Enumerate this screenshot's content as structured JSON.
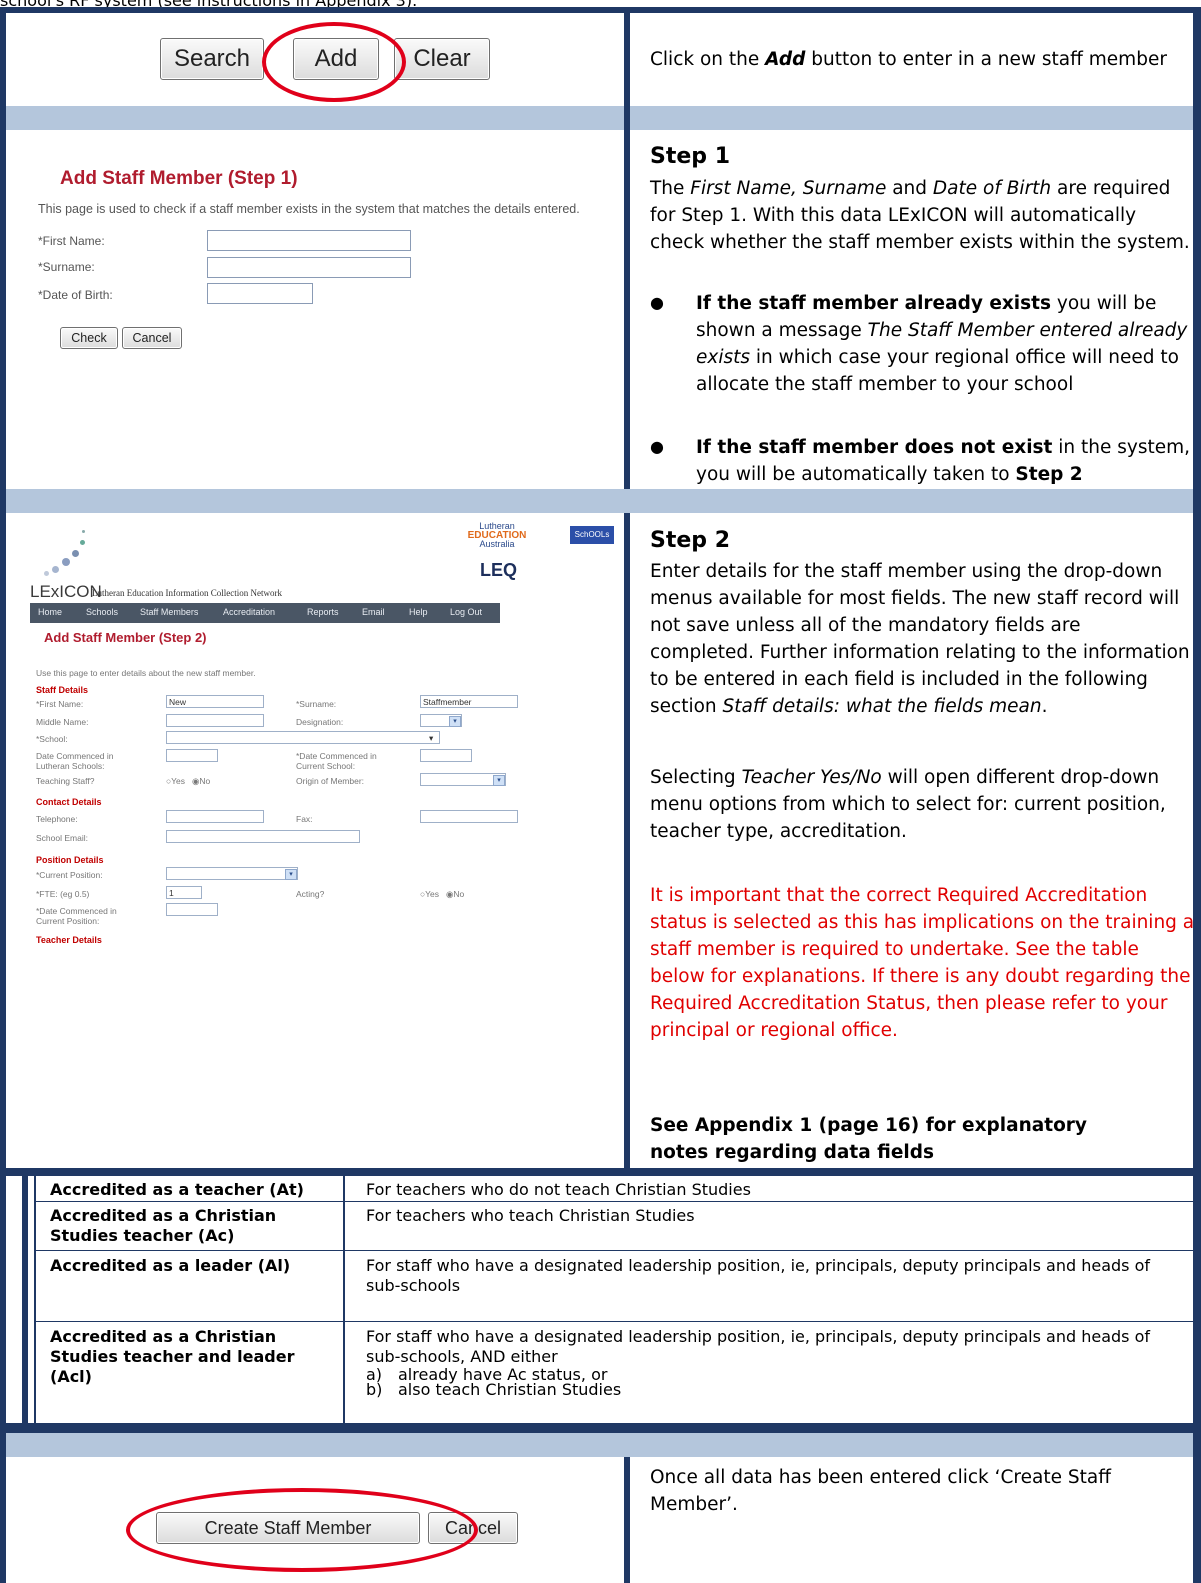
{
  "top_caption": "school's RF system (see instructions in Appendix 3).",
  "row1": {
    "buttons": [
      "Search",
      "Add",
      "Clear"
    ],
    "instruction_pre": "Click on the ",
    "instruction_em": "Add",
    "instruction_post": " button to enter in a new staff member"
  },
  "step1": {
    "screenshot": {
      "title": "Add Staff Member (Step 1)",
      "intro": "This page is used to check if a staff member exists in the system that matches the details entered.",
      "fields": [
        "*First Name:",
        "*Surname:",
        "*Date of Birth:"
      ],
      "buttons": [
        "Check",
        "Cancel"
      ]
    },
    "heading": "Step 1",
    "p1_a": "The ",
    "p1_em1": "First Name, Surname",
    "p1_b": " and ",
    "p1_em2": "Date of Birth",
    "p1_c": " are required for Step 1. With this data LExICON will automatically check whether the staff member exists within the system.",
    "bullet1_bold": "If the staff member already exists",
    "bullet1_a": " you will be shown a message ",
    "bullet1_em": "The Staff Member entered already exists",
    "bullet1_b": " in which case your regional office will need to allocate the staff member to your school",
    "bullet2_bold": "If the staff member does not exist",
    "bullet2_a": " in the system, you will be automatically taken to ",
    "bullet2_bold2": "Step 2"
  },
  "step2": {
    "screenshot": {
      "logo_top": "Lutheran",
      "logo_edu": "EDUCATION",
      "logo_aus": "Australia",
      "logo_schools": "SchOOLs",
      "logo_leq": "LEQ",
      "lexicon": "LExICON",
      "lexicon_sub": "Lutheran Education Information Collection Network",
      "nav": [
        "Home",
        "Schools",
        "Staff Members",
        "Accreditation",
        "Reports",
        "Email",
        "Help",
        "Log Out"
      ],
      "title": "Add Staff Member (Step 2)",
      "intro": "Use this page to enter details about the new staff member.",
      "staff_details": "Staff Details",
      "first_name_label": "*First Name:",
      "first_name_value": "New",
      "surname_label": "*Surname:",
      "surname_value": "Staffmember",
      "middle_name_label": "Middle Name:",
      "designation_label": "Designation:",
      "school_label": "*School:",
      "date_lutheran_label": "Date Commenced in Lutheran Schools:",
      "date_current_school_label": "*Date Commenced in Current School:",
      "teaching_label": "Teaching Staff?",
      "yes": "Yes",
      "no": "No",
      "origin_label": "Origin of Member:",
      "contact_details": "Contact Details",
      "telephone_label": "Telephone:",
      "fax_label": "Fax:",
      "school_email_label": "School Email:",
      "position_details": "Position Details",
      "current_position_label": "*Current Position:",
      "fte_label": "*FTE: (eg 0.5)",
      "fte_value": "1",
      "acting_label": "Acting?",
      "date_current_position_label": "*Date Commenced in Current Position:",
      "teacher_details": "Teacher Details"
    },
    "heading": "Step 2",
    "p1_a": "Enter details for the staff member using the drop-down menus available for most fields. The new staff record will not save unless all of the mandatory fields are completed. Further information relating to the information to be entered in each field is included in the following section ",
    "p1_em": "Staff details: what the fields mean",
    "p1_b": ".",
    "p2_a": "Selecting ",
    "p2_em": "Teacher Yes/No",
    "p2_b": " will open different drop-down menu options from which to select for: current position, teacher type, accreditation.",
    "p3_red": "It is important that the correct Required Accreditation status is selected as this has implications on the training a staff member is required to undertake. See the table below for explanations. If there is any doubt regarding the Required Accreditation Status, then please refer to your principal or regional office.",
    "p4_bold": "See Appendix 1 (page 16) for explanatory notes regarding data fields"
  },
  "accreditation_table": [
    {
      "status": "Accredited as a teacher (At)",
      "desc": "For teachers who do not teach Christian Studies"
    },
    {
      "status": "Accredited as a Christian Studies teacher (Ac)",
      "desc": "For teachers who teach Christian Studies"
    },
    {
      "status": "Accredited as a leader (Al)",
      "desc": "For staff who have a designated leadership position, ie, principals, deputy principals and heads of sub-schools"
    },
    {
      "status": "Accredited as a Christian Studies teacher and leader (Acl)",
      "desc": "For staff who have a designated leadership position, ie, principals, deputy principals and heads of sub-schools, AND either",
      "sub": [
        [
          "a)",
          "already have Ac status, or"
        ],
        [
          "b)",
          "also teach Christian Studies"
        ]
      ]
    }
  ],
  "final": {
    "create_button": "Create Staff Member",
    "cancel_button": "Cancel",
    "instruction": "Once all data has been entered click ‘Create Staff Member’."
  },
  "colors": {
    "border": "#1f3864",
    "band": "#b4c6dc",
    "red_text": "#e00000",
    "highlight_ellipse": "#e0001a",
    "form_heading": "#c00000"
  }
}
